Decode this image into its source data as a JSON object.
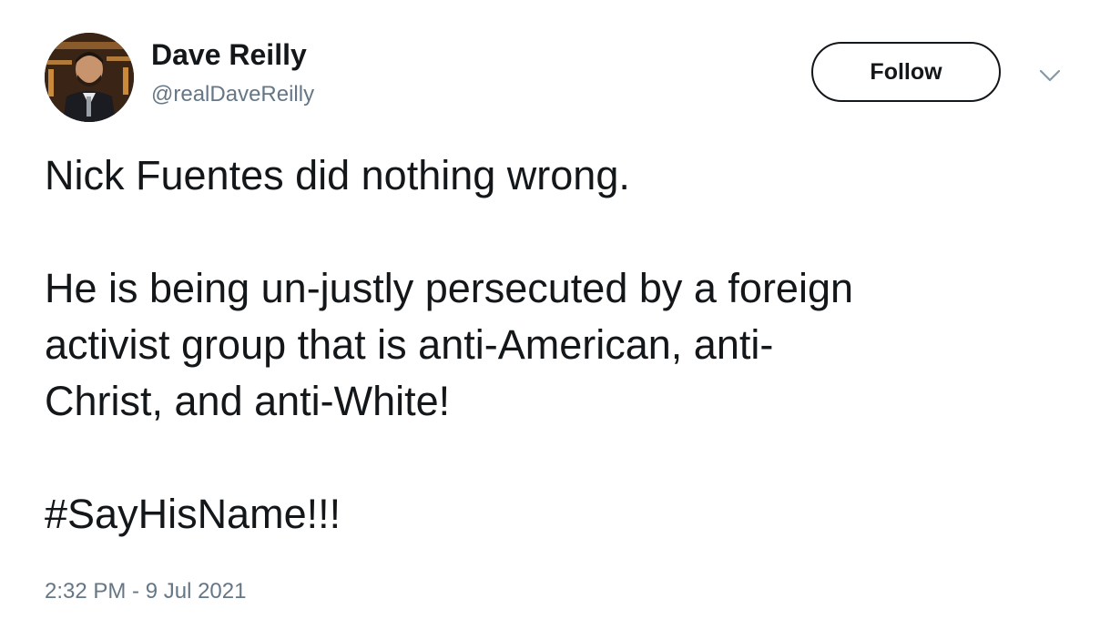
{
  "author": {
    "display_name": "Dave Reilly",
    "handle": "@realDaveReilly"
  },
  "header": {
    "follow_label": "Follow",
    "menu_icon": "chevron-down-icon"
  },
  "tweet": {
    "line1": "Nick Fuentes did nothing wrong.",
    "line2": "He is being un-justly persecuted by a foreign",
    "line3": "activist group that is anti-American, anti-",
    "line4": "Christ, and anti-White!",
    "hashtag": "#SayHisName!!!",
    "timestamp": "2:32 PM - 9 Jul 2021"
  }
}
